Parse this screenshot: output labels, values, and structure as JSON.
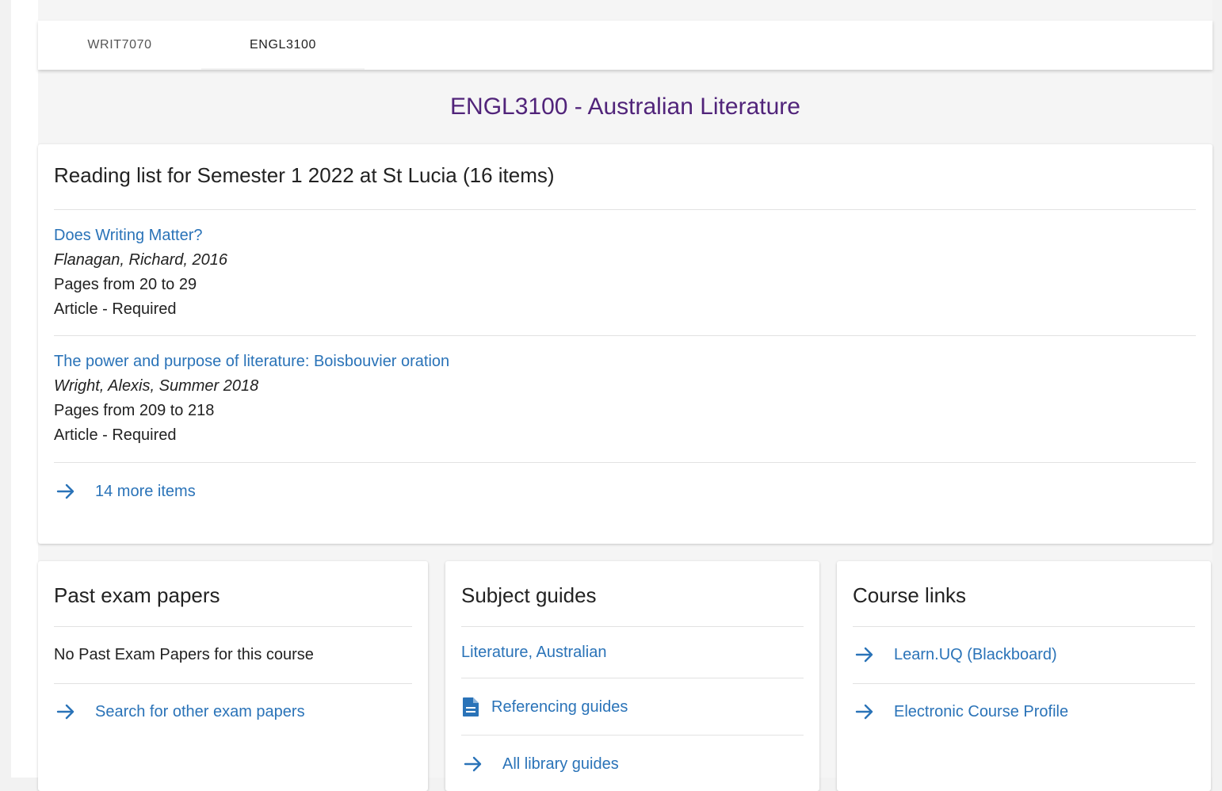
{
  "tabs": [
    {
      "label": "WRIT7070",
      "active": false
    },
    {
      "label": "ENGL3100",
      "active": true
    }
  ],
  "course": {
    "title": "ENGL3100 - Australian Literature"
  },
  "reading_list": {
    "heading": "Reading list for Semester 1 2022 at St Lucia (16 items)",
    "items": [
      {
        "title": "Does Writing Matter?",
        "author": "Flanagan, Richard, 2016",
        "pages": "Pages from 20 to 29",
        "type": "Article - Required"
      },
      {
        "title": "The power and purpose of literature: Boisbouvier oration",
        "author": "Wright, Alexis, Summer 2018",
        "pages": "Pages from 209 to 218",
        "type": "Article - Required"
      }
    ],
    "more_label": "14 more items"
  },
  "past_exams": {
    "heading": "Past exam papers",
    "empty_text": "No Past Exam Papers for this course",
    "search_label": "Search for other exam papers"
  },
  "subject_guides": {
    "heading": "Subject guides",
    "guide_label": "Literature, Australian",
    "referencing_label": "Referencing guides",
    "all_label": "All library guides"
  },
  "course_links": {
    "heading": "Course links",
    "links": [
      {
        "label": "Learn.UQ (Blackboard)"
      },
      {
        "label": "Electronic Course Profile"
      }
    ]
  },
  "colors": {
    "title_purple": "#51247a",
    "link_blue": "#2a73b8",
    "panel_gray": "#f5f5f5"
  },
  "icons": {
    "arrow": "arrow-right-icon",
    "document": "document-icon"
  }
}
